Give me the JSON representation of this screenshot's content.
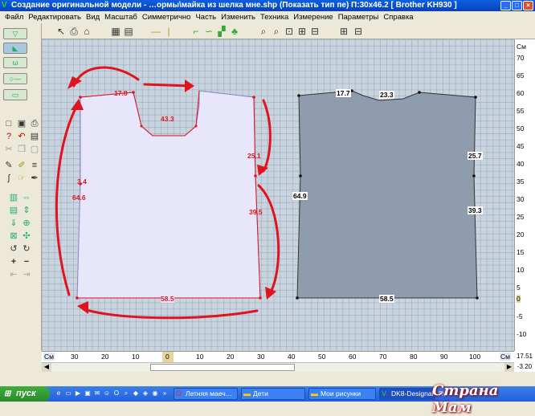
{
  "window": {
    "title": "Создание оригинальной модели - …ормы\\майка из шелка мне.shp (Показать тип пе)    П:30x46.2    [ Brother KH930 ]"
  },
  "menu": [
    "Файл",
    "Редактировать",
    "Вид",
    "Масштаб",
    "Симметрично",
    "Часть",
    "Изменить",
    "Техника",
    "Измерение",
    "Параметры",
    "Справка"
  ],
  "rulers": {
    "unit": "См",
    "v_ticks": [
      "70",
      "65",
      "60",
      "55",
      "50",
      "45",
      "40",
      "35",
      "30",
      "25",
      "20",
      "15",
      "10",
      "5",
      "0",
      "-5",
      "-10"
    ],
    "h_ticks": [
      "30",
      "20",
      "10",
      "0",
      "10",
      "20",
      "30",
      "40",
      "50",
      "60",
      "70",
      "80",
      "90",
      "100"
    ],
    "coord_x": "17.51",
    "coord_y": "-3.20"
  },
  "left_piece": {
    "labels": {
      "top_shoulder": "17.8",
      "neck": "43.3",
      "armhole": "25.1",
      "left_short": "3.4",
      "left_side": "64.6",
      "right_side": "39.5",
      "bottom": "58.5"
    }
  },
  "right_piece": {
    "labels": {
      "shoulder_left": "17.7",
      "neck": "23.3",
      "armhole": "25.7",
      "left_side": "64.9",
      "right_side": "39.3",
      "bottom": "58.5"
    }
  },
  "colors": {
    "piece_fill_left": "#e8e6fa",
    "piece_fill_right": "#8e9cae",
    "annotation_red": "#e0141e"
  },
  "taskbar": {
    "start": "пуск",
    "tasks": [
      "Летняя маеч…",
      "Дети",
      "Мои рисунки",
      "DK8-DesignaK…"
    ],
    "extra": "Ru"
  },
  "watermark": "Страна Мам"
}
